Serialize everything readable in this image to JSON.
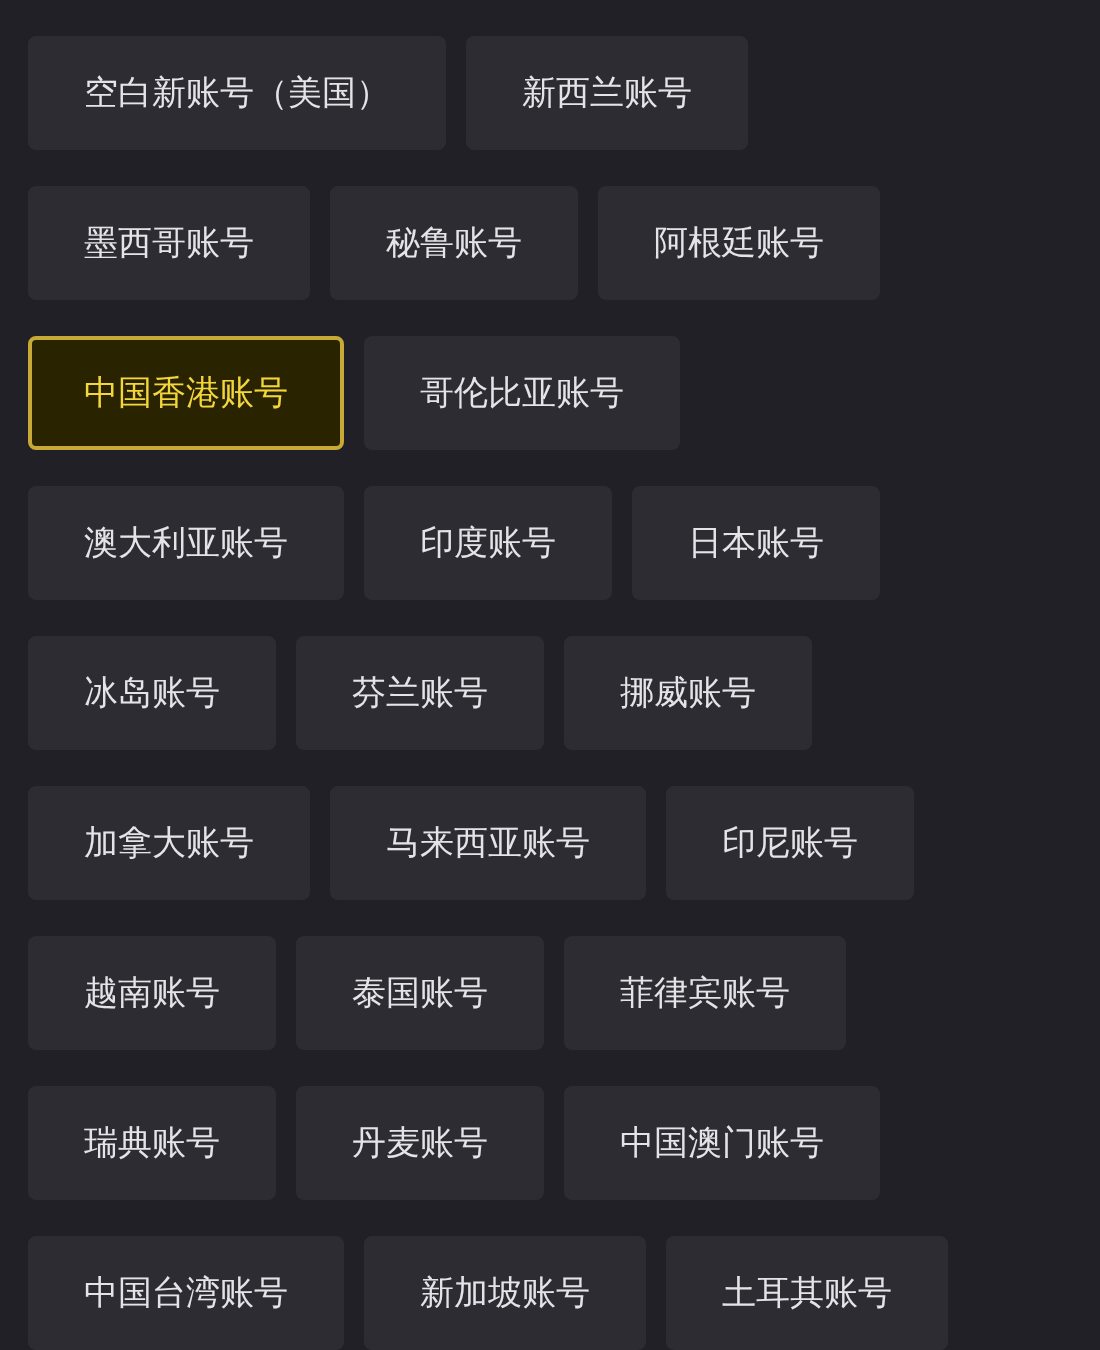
{
  "rows": [
    [
      {
        "label": "空白新账号（美国）",
        "selected": false
      },
      {
        "label": "新西兰账号",
        "selected": false
      }
    ],
    [
      {
        "label": "墨西哥账号",
        "selected": false
      },
      {
        "label": "秘鲁账号",
        "selected": false
      },
      {
        "label": "阿根廷账号",
        "selected": false
      }
    ],
    [
      {
        "label": "中国香港账号",
        "selected": true
      },
      {
        "label": "哥伦比亚账号",
        "selected": false
      }
    ],
    [
      {
        "label": "澳大利亚账号",
        "selected": false
      },
      {
        "label": "印度账号",
        "selected": false
      },
      {
        "label": "日本账号",
        "selected": false
      }
    ],
    [
      {
        "label": "冰岛账号",
        "selected": false
      },
      {
        "label": "芬兰账号",
        "selected": false
      },
      {
        "label": "挪威账号",
        "selected": false
      }
    ],
    [
      {
        "label": "加拿大账号",
        "selected": false
      },
      {
        "label": "马来西亚账号",
        "selected": false
      },
      {
        "label": "印尼账号",
        "selected": false
      }
    ],
    [
      {
        "label": "越南账号",
        "selected": false
      },
      {
        "label": "泰国账号",
        "selected": false
      },
      {
        "label": "菲律宾账号",
        "selected": false
      }
    ],
    [
      {
        "label": "瑞典账号",
        "selected": false
      },
      {
        "label": "丹麦账号",
        "selected": false
      },
      {
        "label": "中国澳门账号",
        "selected": false
      }
    ],
    [
      {
        "label": "中国台湾账号",
        "selected": false
      },
      {
        "label": "新加坡账号",
        "selected": false
      },
      {
        "label": "土耳其账号",
        "selected": false
      }
    ]
  ]
}
